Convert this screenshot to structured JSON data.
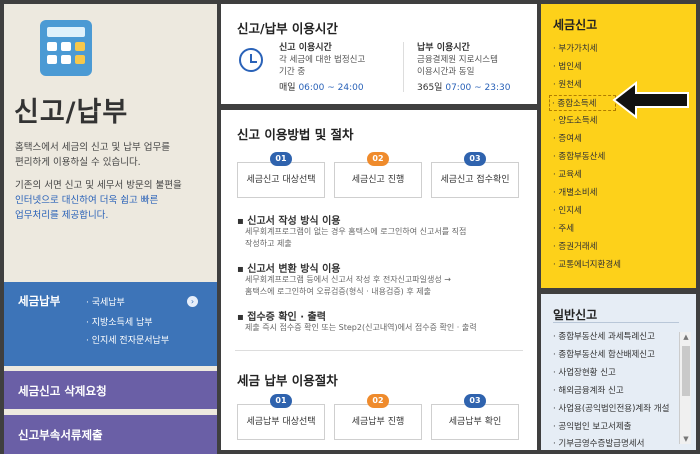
{
  "left": {
    "title": "신고/납부",
    "desc1_line1": "홈택스에서 세금의 신고 및 납부 업무를",
    "desc1_line2": "편리하게 이용하실 수 있습니다.",
    "desc2_line1": "기존의 서면 신고 및 세무서 방문의 불편을",
    "desc2_line2": "인터넷으로 대신하여 더욱 쉽고 빠른",
    "desc2_line3": "업무처리를 제공합니다.",
    "menu_tax_payment": "세금납부",
    "menu_sub": [
      "· 국세납부",
      "· 지방소득세 납부",
      "· 인지세 전자문서납부"
    ],
    "menu_delete": "세금신고 삭제요청",
    "menu_docs": "신고부속서류제출"
  },
  "hours": {
    "title": "신고/납부 이용시간",
    "filing_title": "신고 이용시간",
    "filing_desc1": "각 세금에 대한 법정신고",
    "filing_desc2": "기간 중",
    "filing_days": "매일",
    "filing_time": "06:00 ~ 24:00",
    "pay_title": "납부 이용시간",
    "pay_desc1": "금융결제원 지로시스템",
    "pay_desc2": "이용시간과 동일",
    "pay_days": "365일",
    "pay_time": "07:00 ~ 23:30"
  },
  "method": {
    "title": "신고 이용방법 및 절차",
    "steps": [
      {
        "num": "01",
        "label": "세금신고 대상선택"
      },
      {
        "num": "02",
        "label": "세금신고 진행"
      },
      {
        "num": "03",
        "label": "세금신고 접수확인"
      }
    ],
    "b1_title": "신고서 작성 방식 이용",
    "b1_desc1": "세무회계프로그램이 없는 경우 홈택스에 로그인하여 신고서를 직접",
    "b1_desc2": "작성하고 제출",
    "b2_title": "신고서 변환 방식 이용",
    "b2_desc1": "세무회계프로그램 등에서 신고서 작성 후 전자신고파일생성 →",
    "b2_desc2": "홈택스에 로그인하여 오류검증(형식 · 내용검증) 후 제출",
    "b3_title": "접수증 확인 · 출력",
    "b3_desc1": "제출 즉시 접수증 확인 또는 Step2(신고내역)에서 접수증 확인 · 출력"
  },
  "payment": {
    "title": "세금 납부 이용절차",
    "steps": [
      {
        "num": "01",
        "label": "세금납부 대상선택"
      },
      {
        "num": "02",
        "label": "세금납부 진행"
      },
      {
        "num": "03",
        "label": "세금납부 확인"
      }
    ]
  },
  "tax_filing": {
    "title": "세금신고",
    "items": [
      "· 부가가치세",
      "· 법인세",
      "· 원천세",
      "· 종합소득세",
      "· 양도소득세",
      "· 증여세",
      "· 종합부동산세",
      "· 교육세",
      "· 개별소비세",
      "· 인지세",
      "· 주세",
      "· 증권거래세",
      "· 교통에너지환경세"
    ],
    "highlighted_index": 3
  },
  "general_filing": {
    "title": "일반신고",
    "items": [
      "· 종합부동산세 과세특례신고",
      "· 종합부동산세 합산배제신고",
      "· 사업장현황 신고",
      "· 해외금융계좌 신고",
      "· 사업용(공익법인전용)계좌 개설",
      "· 공익법인 보고서제출",
      "· 기부금영수증발급명세서"
    ]
  },
  "colors": {
    "accent": "#2a62b8",
    "yellow": "#fdd11a",
    "purple": "#6a5fa6",
    "blue_menu": "#3d74b8",
    "step_blue": "#2f63ae",
    "step_orange": "#ef8b2c"
  },
  "icons": [
    "calculator-icon",
    "clock-icon",
    "chevron-right-icon",
    "pointer-arrow-icon"
  ]
}
